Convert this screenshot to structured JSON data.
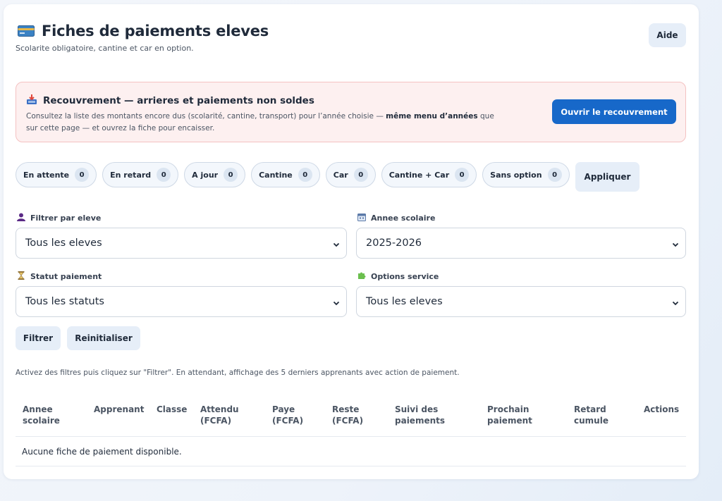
{
  "header": {
    "title": "Fiches de paiements eleves",
    "subtitle": "Scolarite obligatoire, cantine et car en option.",
    "help_label": "Aide",
    "title_icon": "credit-card-icon"
  },
  "alert": {
    "icon": "inbox-tray-icon",
    "title": "Recouvrement — arrieres et paiements non soldes",
    "text_1": "Consultez la liste des montants encore dus (scolarité, cantine, transport) pour l’année choisie — ",
    "text_bold_1": "même menu d’années",
    "text_2": " que sur cette page — et ouvrez la fiche pour encaisser.",
    "button_label": "Ouvrir le recouvrement"
  },
  "chips": [
    {
      "label": "En attente",
      "count": "0"
    },
    {
      "label": "En retard",
      "count": "0"
    },
    {
      "label": "A jour",
      "count": "0"
    },
    {
      "label": "Cantine",
      "count": "0"
    },
    {
      "label": "Car",
      "count": "0"
    },
    {
      "label": "Cantine + Car",
      "count": "0"
    },
    {
      "label": "Sans option",
      "count": "0"
    }
  ],
  "apply_label": "Appliquer",
  "filters": {
    "student": {
      "label": "Filtrer par eleve",
      "value": "Tous les eleves",
      "icon": "person-icon"
    },
    "year": {
      "label": "Annee scolaire",
      "value": "2025-2026",
      "icon": "calendar-icon"
    },
    "status": {
      "label": "Statut paiement",
      "value": "Tous les statuts",
      "icon": "hourglass-icon"
    },
    "options": {
      "label": "Options service",
      "value": "Tous les eleves",
      "icon": "puzzle-icon"
    }
  },
  "actions": {
    "filter_label": "Filtrer",
    "reset_label": "Reinitialiser"
  },
  "hint": "Activez des filtres puis cliquez sur \"Filtrer\". En attendant, affichage des 5 derniers apprenants avec action de paiement.",
  "table": {
    "columns": [
      [
        "Annee",
        "scolaire"
      ],
      [
        "Apprenant",
        ""
      ],
      [
        "Classe",
        ""
      ],
      [
        "Attendu",
        "(FCFA)"
      ],
      [
        "Paye",
        "(FCFA)"
      ],
      [
        "Reste",
        "(FCFA)"
      ],
      [
        "Suivi des",
        "paiements"
      ],
      [
        "Prochain",
        "paiement"
      ],
      [
        "Retard",
        "cumule"
      ],
      [
        "Actions",
        ""
      ]
    ],
    "empty_message": "Aucune fiche de paiement disponible."
  },
  "colors": {
    "primary": "#1768c9",
    "alert_bg": "#fdf0f0",
    "alert_border": "#f4c1c1"
  }
}
